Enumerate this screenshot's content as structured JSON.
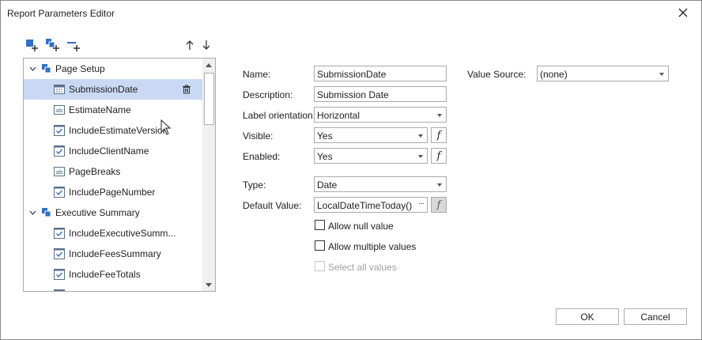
{
  "window": {
    "title": "Report Parameters Editor"
  },
  "tree": {
    "groups": [
      {
        "label": "Page Setup"
      },
      {
        "label": "Executive Summary"
      }
    ],
    "items": [
      {
        "label": "SubmissionDate"
      },
      {
        "label": "EstimateName"
      },
      {
        "label": "IncludeEstimateVersion"
      },
      {
        "label": "IncludeClientName"
      },
      {
        "label": "PageBreaks"
      },
      {
        "label": "IncludePageNumber"
      },
      {
        "label": "IncludeExecutiveSumm..."
      },
      {
        "label": "IncludeFeesSummary"
      },
      {
        "label": "IncludeFeeTotals"
      }
    ]
  },
  "form": {
    "name_label": "Name:",
    "name_value": "SubmissionDate",
    "description_label": "Description:",
    "description_value": "Submission Date",
    "orientation_label": "Label orientation:",
    "orientation_value": "Horizontal",
    "visible_label": "Visible:",
    "visible_value": "Yes",
    "enabled_label": "Enabled:",
    "enabled_value": "Yes",
    "type_label": "Type:",
    "type_value": "Date",
    "default_label": "Default Value:",
    "default_value": "LocalDateTimeToday()",
    "ellipsis": "···",
    "fx_glyph": "f",
    "value_source_label": "Value Source:",
    "value_source_value": "(none)"
  },
  "checks": {
    "allow_null": "Allow null value",
    "allow_multiple": "Allow multiple values",
    "select_all": "Select all values"
  },
  "buttons": {
    "ok": "OK",
    "cancel": "Cancel"
  }
}
